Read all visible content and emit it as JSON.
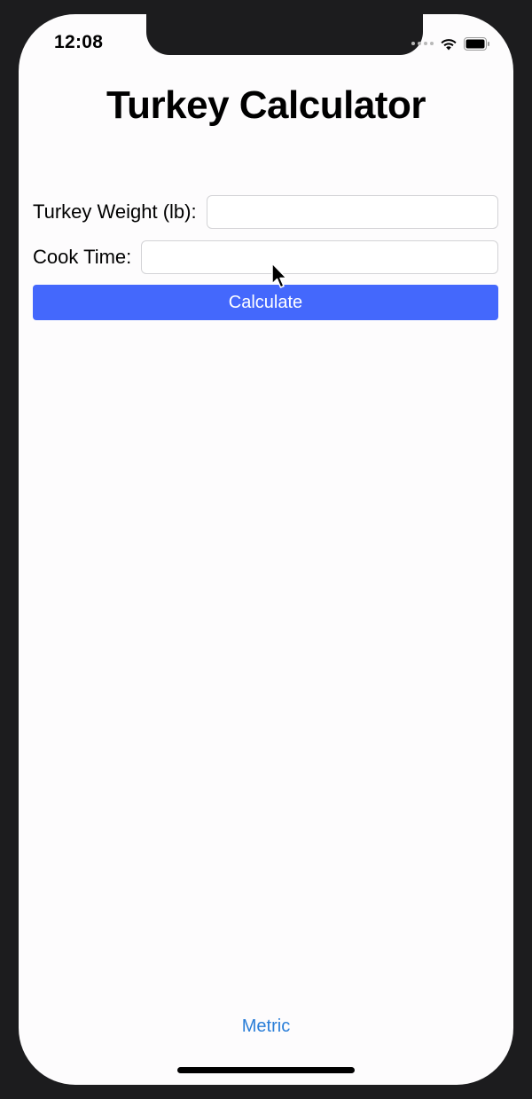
{
  "status_bar": {
    "time": "12:08",
    "icons": [
      "signal-dots-icon",
      "wifi-icon",
      "battery-icon"
    ]
  },
  "page": {
    "title": "Turkey Calculator"
  },
  "form": {
    "weight_label": "Turkey Weight (lb):",
    "weight_value": "",
    "cook_time_label": "Cook Time:",
    "cook_time_value": "",
    "calculate_label": "Calculate"
  },
  "footer": {
    "metric_label": "Metric"
  },
  "colors": {
    "accent": "#4468fc",
    "link": "#2a7ed8",
    "background": "#fdfcfd",
    "device": "#1c1c1e"
  }
}
